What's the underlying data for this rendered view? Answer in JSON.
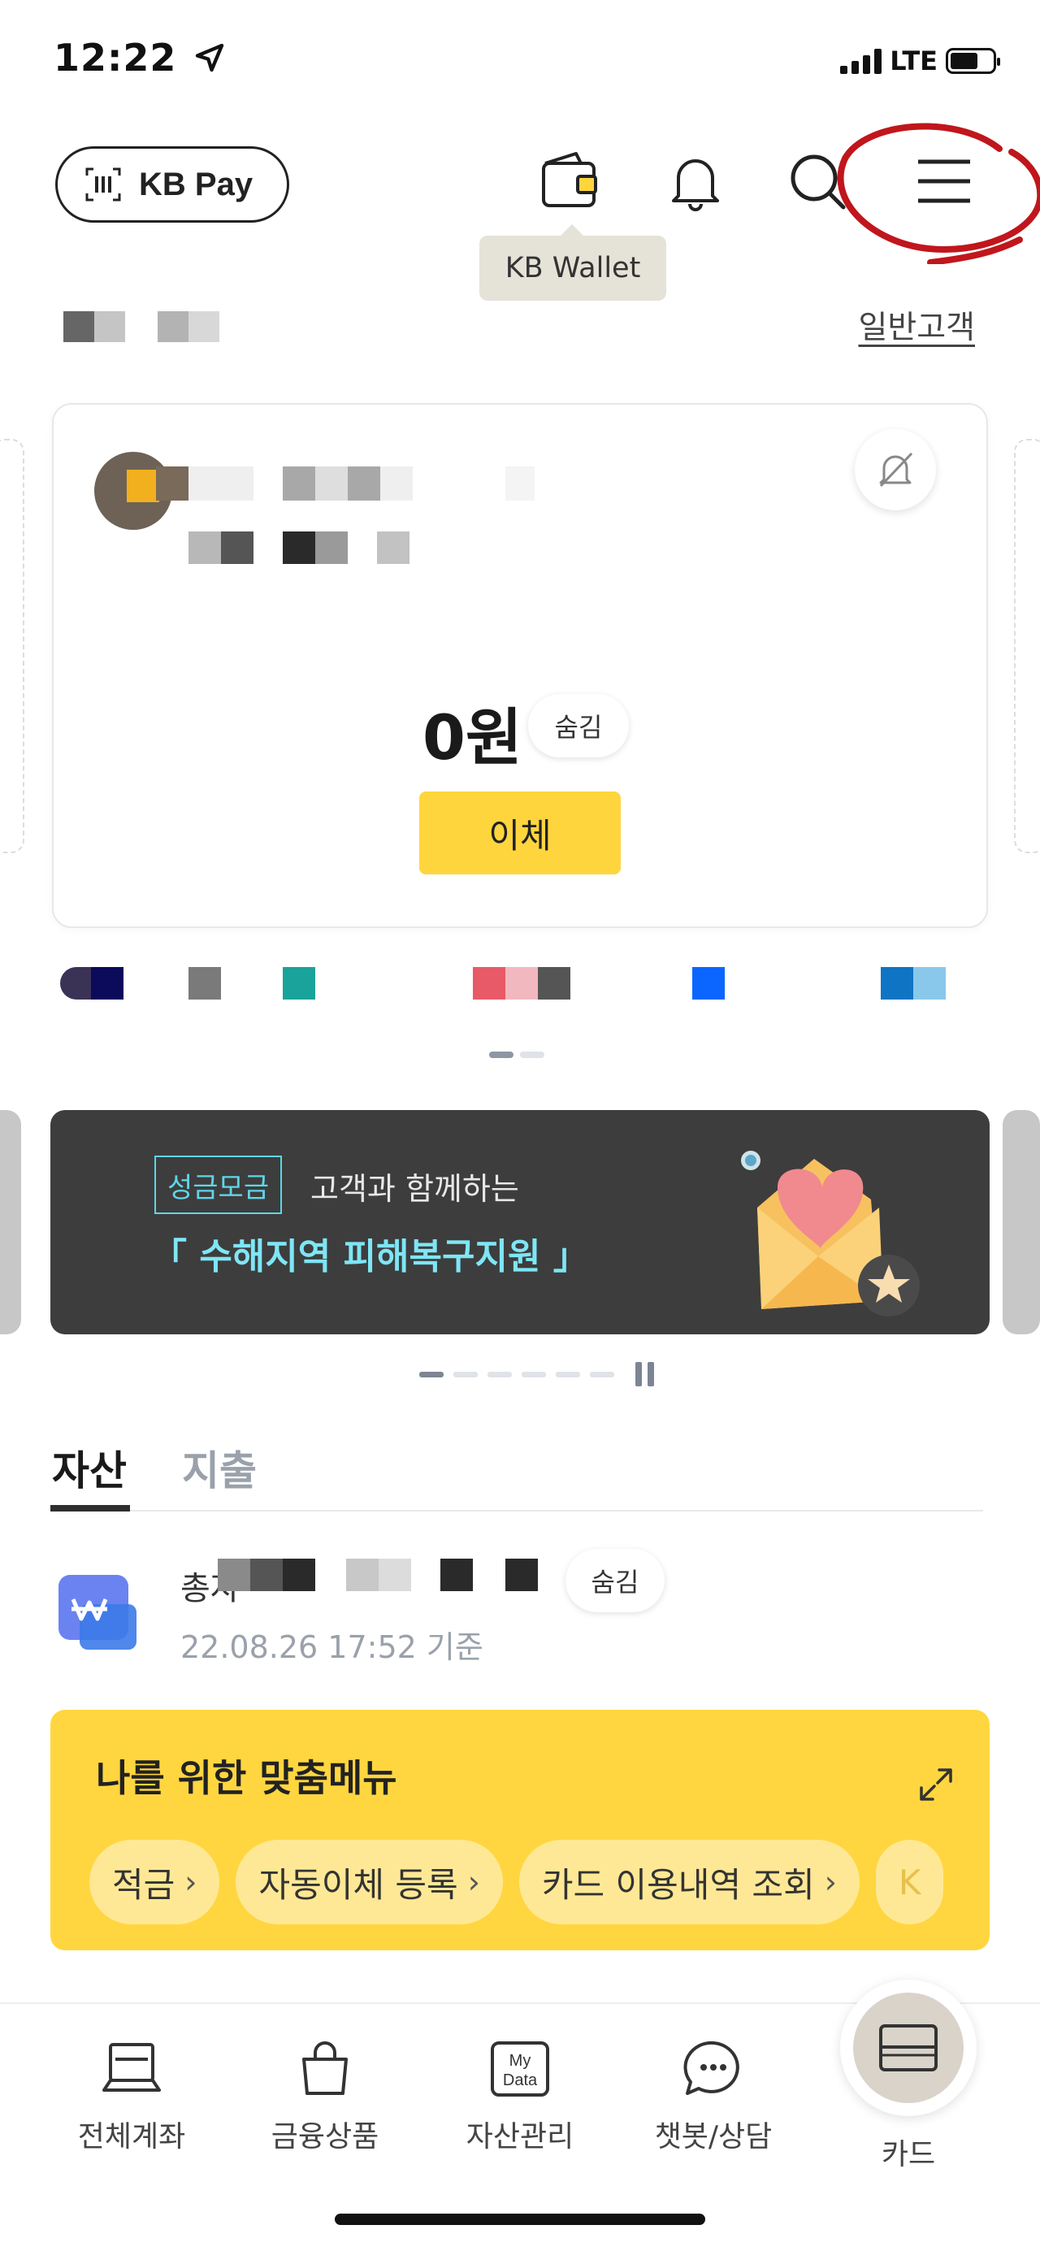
{
  "status_bar": {
    "time": "12:22",
    "network": "LTE"
  },
  "header": {
    "kbpay_label": "KB Pay",
    "wallet_tooltip": "KB Wallet"
  },
  "customer_type": "일반고객",
  "account": {
    "balance": "0원",
    "hide_label": "숨김",
    "transfer_label": "이체"
  },
  "banner": {
    "tag": "성금모금",
    "subtitle": "고객과 함께하는",
    "title": "「 수해지역 피해복구지원 」"
  },
  "asset_tabs": [
    {
      "label": "자산",
      "active": true
    },
    {
      "label": "지출",
      "active": false
    }
  ],
  "asset_summary": {
    "title_prefix": "총자",
    "hide_label": "숨김",
    "date": "22.08.26 17:52 기준"
  },
  "custom_menu": {
    "title": "나를 위한 맞춤메뉴",
    "chips": [
      {
        "label": "적금"
      },
      {
        "label": "자동이체 등록"
      },
      {
        "label": "카드 이용내역 조회"
      }
    ],
    "overflow_chip": "K"
  },
  "tabbar": {
    "items": [
      {
        "label": "전체계좌",
        "icon": "laptop-icon"
      },
      {
        "label": "금융상품",
        "icon": "shopping-bag-icon"
      },
      {
        "label": "자산관리",
        "icon": "mydata-icon",
        "badge_text": "My Data"
      },
      {
        "label": "챗봇/상담",
        "icon": "chat-bubble-icon"
      },
      {
        "label": "카드",
        "icon": "card-icon"
      }
    ]
  },
  "colors": {
    "kb_yellow": "#ffd53e",
    "banner_bg": "#3d3d3d",
    "banner_accent": "#7ee6f5",
    "annotation_red": "#c0161c"
  }
}
